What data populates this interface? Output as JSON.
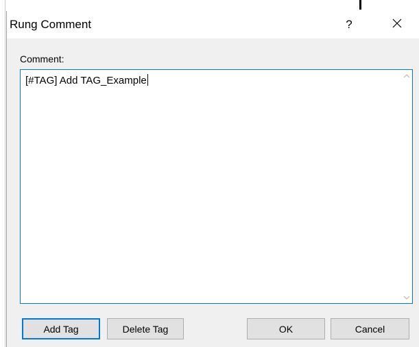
{
  "dialog": {
    "title": "Rung Comment",
    "help_symbol": "?",
    "comment_label": "Comment:",
    "comment_text": "[#TAG] Add TAG_Example",
    "buttons": {
      "add_tag": "Add Tag",
      "delete_tag": "Delete Tag",
      "ok": "OK",
      "cancel": "Cancel"
    }
  },
  "icons": {
    "close": "close-icon",
    "scroll_up": "chevron-up-icon",
    "scroll_down": "chevron-down-icon"
  },
  "colors": {
    "accent": "#0078d7",
    "dialog_bg": "#f0f0f0",
    "button_bg": "#e1e1e1"
  }
}
